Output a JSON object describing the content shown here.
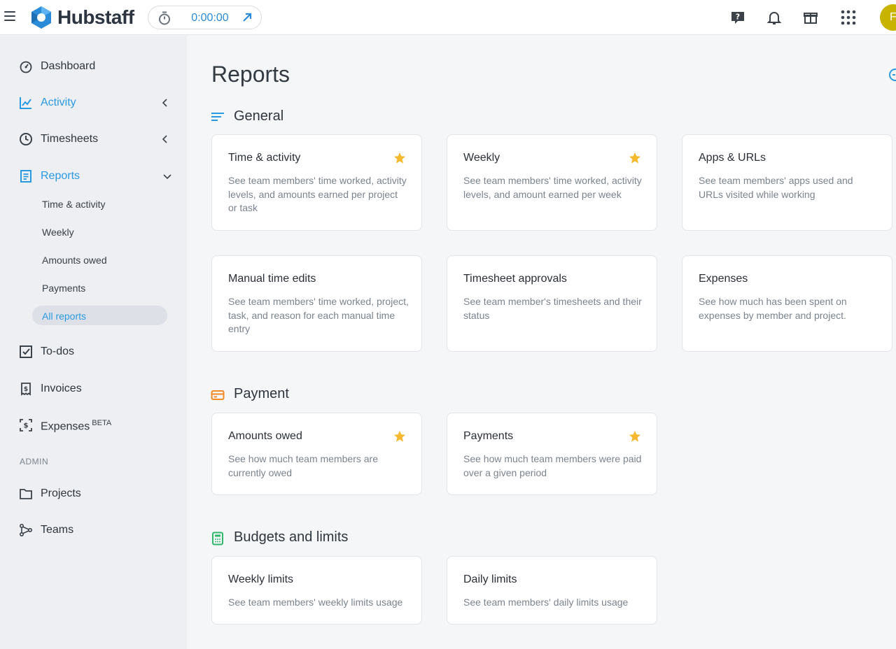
{
  "app": {
    "name": "Hubstaff"
  },
  "colors": {
    "accent": "#2a9ae0",
    "star": "#f5b82e",
    "payment_icon": "#f08a24",
    "budget_icon": "#2fb86c",
    "avatar": "#c8b400"
  },
  "timer": {
    "value": "0:00:00"
  },
  "user": {
    "initial": "F"
  },
  "sidebar": {
    "items": [
      {
        "label": "Dashboard",
        "icon": "dashboard-icon"
      },
      {
        "label": "Activity",
        "icon": "activity-icon"
      },
      {
        "label": "Timesheets",
        "icon": "clock-icon"
      },
      {
        "label": "Reports",
        "icon": "reports-icon"
      },
      {
        "label": "To-dos",
        "icon": "todo-icon"
      },
      {
        "label": "Invoices",
        "icon": "invoice-icon"
      },
      {
        "label": "Expenses",
        "icon": "expenses-icon",
        "badge": "BETA"
      },
      {
        "label": "Projects",
        "icon": "folder-icon"
      },
      {
        "label": "Teams",
        "icon": "teams-icon"
      }
    ],
    "report_subitems": [
      "Time & activity",
      "Weekly",
      "Amounts owed",
      "Payments",
      "All reports"
    ],
    "admin_label": "ADMIN"
  },
  "main": {
    "title": "Reports",
    "sections": [
      {
        "title": "General",
        "cards": [
          {
            "title": "Time & activity",
            "desc": "See team members' time worked, activity levels, and amounts earned per project or task",
            "starred": true
          },
          {
            "title": "Weekly",
            "desc": "See team members' time worked, activity levels, and amount earned per week",
            "starred": true
          },
          {
            "title": "Apps & URLs",
            "desc": "See team members' apps used and URLs visited while working",
            "starred": false
          },
          {
            "title": "Manual time edits",
            "desc": "See team members' time worked, project, task, and reason for each manual time entry",
            "starred": false
          },
          {
            "title": "Timesheet approvals",
            "desc": "See team member's timesheets and their status",
            "starred": false
          },
          {
            "title": "Expenses",
            "desc": "See how much has been spent on expenses by member and project.",
            "starred": false
          }
        ]
      },
      {
        "title": "Payment",
        "cards": [
          {
            "title": "Amounts owed",
            "desc": "See how much team members are currently owed",
            "starred": true
          },
          {
            "title": "Payments",
            "desc": "See how much team members were paid over a given period",
            "starred": true
          }
        ]
      },
      {
        "title": "Budgets and limits",
        "cards": [
          {
            "title": "Weekly limits",
            "desc": "See team members' weekly limits usage",
            "starred": false
          },
          {
            "title": "Daily limits",
            "desc": "See team members' daily limits usage",
            "starred": false
          }
        ]
      }
    ]
  }
}
